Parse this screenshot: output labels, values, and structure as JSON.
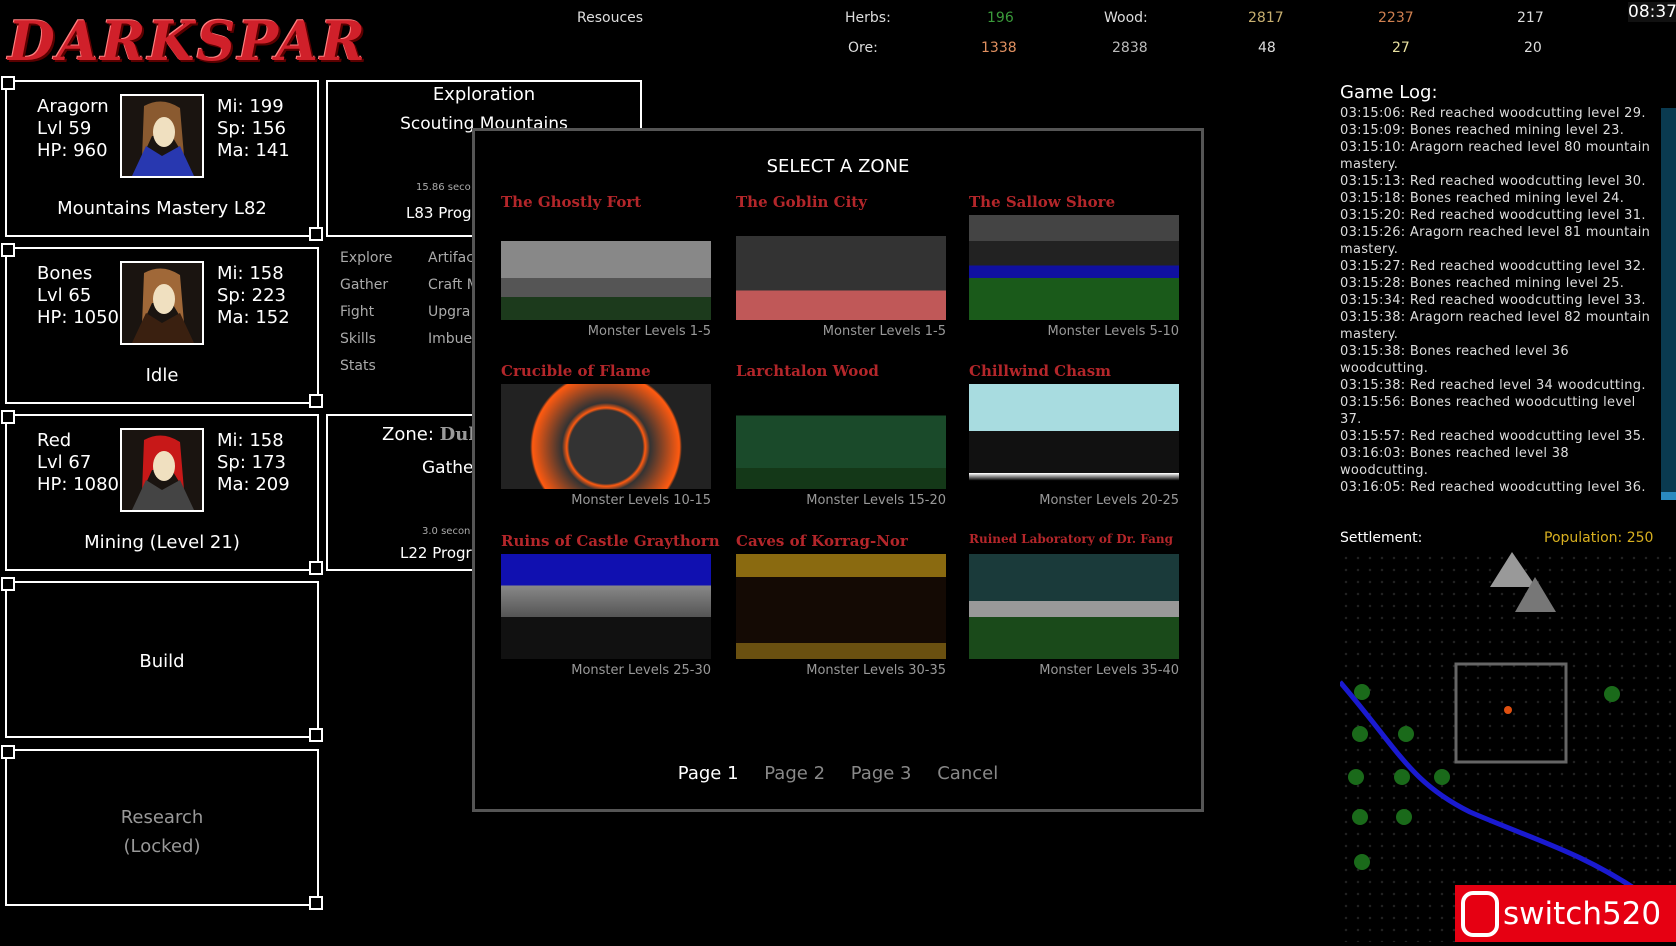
{
  "logo": "DARKSPAR",
  "clock": "08:37",
  "resources": {
    "label": "Resouces",
    "herbs_label": "Herbs:",
    "herbs": "196",
    "wood_label": "Wood:",
    "wood": [
      "2817",
      "2237",
      "217"
    ],
    "ore_label": "Ore:",
    "ore": [
      "1338",
      "2838",
      "48",
      "27",
      "20"
    ]
  },
  "characters": [
    {
      "name": "Aragorn",
      "level": "Lvl 59",
      "hp": "HP: 960",
      "mi": "Mi: 199",
      "sp": "Sp: 156",
      "ma": "Ma: 141",
      "status": "Mountains Mastery L82",
      "hair": "#8a5a30",
      "cloak": "#2838b0"
    },
    {
      "name": "Bones",
      "level": "Lvl 65",
      "hp": "HP: 1050",
      "mi": "Mi: 158",
      "sp": "Sp: 223",
      "ma": "Ma: 152",
      "status": "Idle",
      "hair": "#a06838",
      "cloak": "#3a2010"
    },
    {
      "name": "Red",
      "level": "Lvl 67",
      "hp": "HP: 1080",
      "mi": "Mi: 158",
      "sp": "Sp: 173",
      "ma": "Ma: 209",
      "status": "Mining (Level 21)",
      "hair": "#c81818",
      "cloak": "#444"
    }
  ],
  "build": "Build",
  "research": [
    "Research",
    "(Locked)"
  ],
  "exploration": {
    "title": "Exploration",
    "activity": "Scouting Mountains",
    "timer": "15.86 seco",
    "progress": "L83 Prog"
  },
  "menu": {
    "col1": [
      "Explore",
      "Gather",
      "Fight",
      "Skills",
      "Stats"
    ],
    "col2": [
      "Artifac",
      "Craft M",
      "Upgra",
      "Imbue"
    ]
  },
  "zone_panel": {
    "label": "Zone:",
    "value": "Dul",
    "activity": "Gathe",
    "timer": "3.0 secon",
    "progress": "L22 Progr"
  },
  "modal": {
    "title": "SELECT A ZONE",
    "zones": [
      {
        "name": "The Ghostly Fort",
        "levels": "Monster Levels 1-5"
      },
      {
        "name": "The Goblin City",
        "levels": "Monster Levels 1-5"
      },
      {
        "name": "The Sallow Shore",
        "levels": "Monster Levels 5-10"
      },
      {
        "name": "Crucible of Flame",
        "levels": "Monster Levels 10-15"
      },
      {
        "name": "Larchtalon Wood",
        "levels": "Monster Levels 15-20"
      },
      {
        "name": "Chillwind Chasm",
        "levels": "Monster Levels 20-25"
      },
      {
        "name": "Ruins of Castle Graythorn",
        "levels": "Monster Levels 25-30"
      },
      {
        "name": "Caves of Korrag-Nor",
        "levels": "Monster Levels 30-35"
      },
      {
        "name": "Ruined Laboratory of Dr. Fang",
        "levels": "Monster Levels 35-40"
      }
    ],
    "pages": [
      "Page 1",
      "Page 2",
      "Page 3"
    ],
    "active_page": "Page 1",
    "cancel": "Cancel"
  },
  "log": {
    "title": "Game Log:",
    "lines": [
      "03:15:06: Red reached woodcutting level 29.",
      "03:15:09: Bones reached mining level 23.",
      "03:15:10: Aragorn reached level 80 mountain mastery.",
      "03:15:13: Red reached woodcutting level 30.",
      "03:15:18: Bones reached mining level 24.",
      "03:15:20: Red reached woodcutting level 31.",
      "03:15:26: Aragorn reached level 81 mountain mastery.",
      "03:15:27: Red reached woodcutting level 32.",
      "03:15:28: Bones reached mining level 25.",
      "03:15:34: Red reached woodcutting level 33.",
      "03:15:38: Aragorn reached level 82 mountain mastery.",
      "03:15:38: Bones reached level 36 woodcutting.",
      "03:15:38: Red reached level 34 woodcutting.",
      "03:15:56: Bones reached woodcutting level 37.",
      "03:15:57: Red reached woodcutting level 35.",
      "03:16:03: Bones reached level 38 woodcutting.",
      "03:16:05: Red reached woodcutting level 36."
    ]
  },
  "settlement": {
    "label": "Settlement:",
    "population": "Population: 250"
  },
  "watermark": "switch520"
}
